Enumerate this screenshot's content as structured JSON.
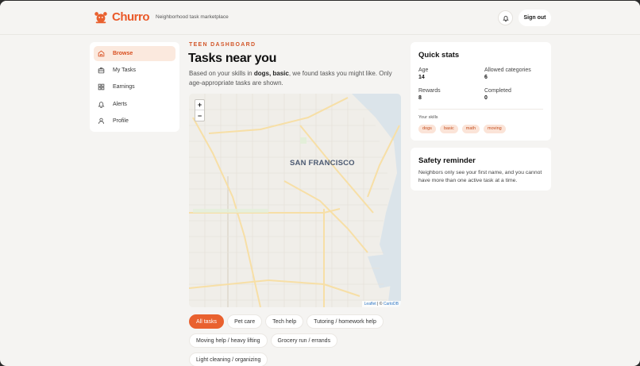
{
  "header": {
    "brand": "Churro",
    "tagline": "Neighborhood task marketplace",
    "sign_out_label": "Sign out"
  },
  "sidebar": {
    "items": [
      {
        "label": "Browse",
        "icon": "home-icon",
        "active": true
      },
      {
        "label": "My Tasks",
        "icon": "briefcase-icon",
        "active": false
      },
      {
        "label": "Earnings",
        "icon": "grid-icon",
        "active": false
      },
      {
        "label": "Alerts",
        "icon": "bell-icon",
        "active": false
      },
      {
        "label": "Profile",
        "icon": "user-icon",
        "active": false
      }
    ]
  },
  "main": {
    "eyebrow": "TEEN DASHBOARD",
    "title": "Tasks near you",
    "intro_prefix": "Based on your skills in ",
    "intro_skills": "dogs, basic",
    "intro_suffix": ", we found tasks you might like. Only age-appropriate tasks are shown.",
    "map": {
      "zoom_in": "+",
      "zoom_out": "−",
      "city_label": "SAN FRANCISCO",
      "attribution_leaflet": "Leaflet",
      "attribution_sep": " | © ",
      "attribution_carto": "CartoDB"
    },
    "categories": [
      {
        "label": "All tasks",
        "active": true
      },
      {
        "label": "Pet care",
        "active": false
      },
      {
        "label": "Tech help",
        "active": false
      },
      {
        "label": "Tutoring / homework help",
        "active": false
      },
      {
        "label": "Moving help / heavy lifting",
        "active": false
      },
      {
        "label": "Grocery run / errands",
        "active": false
      },
      {
        "label": "Light cleaning / organizing",
        "active": false
      }
    ]
  },
  "quick_stats": {
    "title": "Quick stats",
    "age_label": "Age",
    "age_value": "14",
    "allowed_label": "Allowed categories",
    "allowed_value": "6",
    "rewards_label": "Rewards",
    "rewards_value": "8",
    "completed_label": "Completed",
    "completed_value": "0",
    "skills_label": "Your skills",
    "skills": [
      "dogs",
      "basic",
      "math",
      "moving"
    ]
  },
  "safety": {
    "title": "Safety reminder",
    "text": "Neighbors only see your first name, and you cannot have more than one active task at a time."
  },
  "colors": {
    "accent": "#e9612f",
    "accent_light": "#fbe9de",
    "background": "#f5f4f2"
  }
}
